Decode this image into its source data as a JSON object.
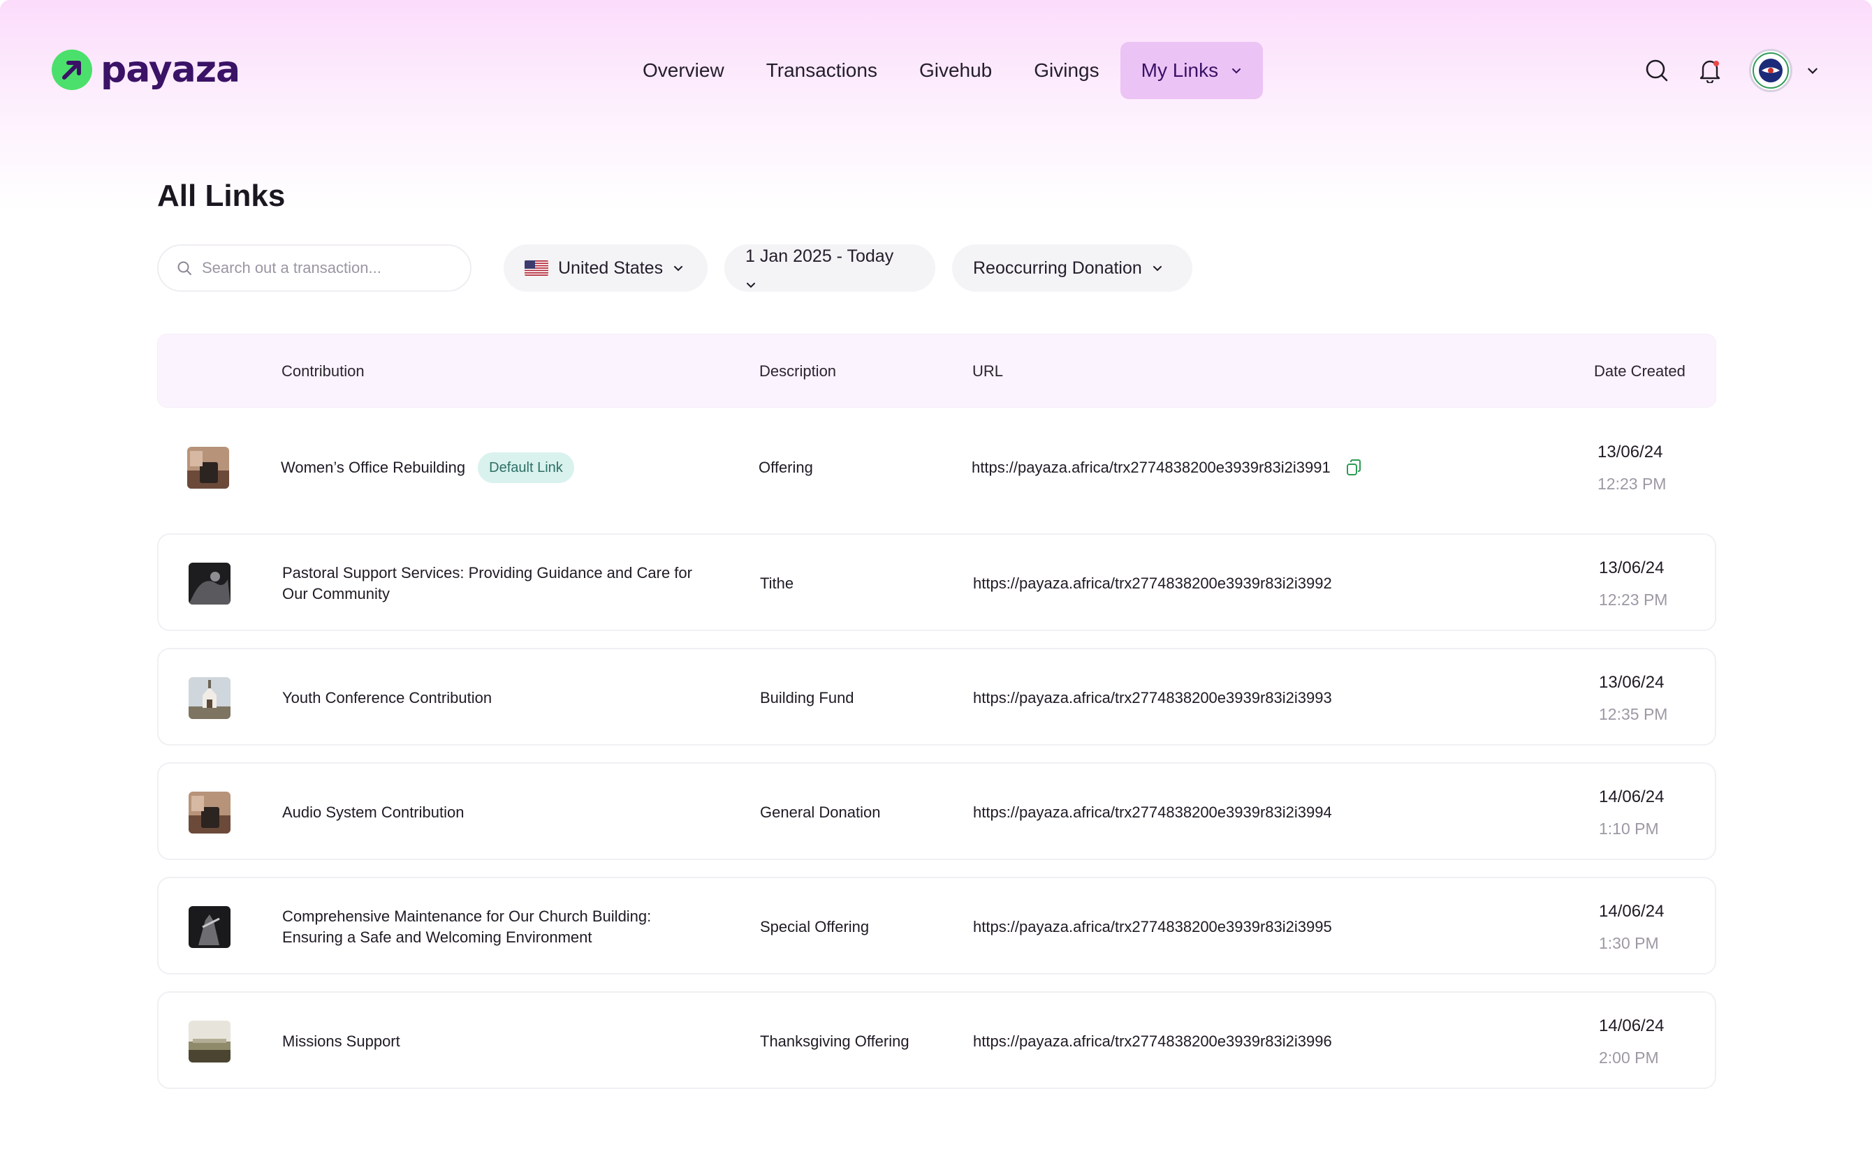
{
  "brand": {
    "name": "payaza"
  },
  "nav": {
    "items": [
      {
        "label": "Overview"
      },
      {
        "label": "Transactions"
      },
      {
        "label": "Givehub"
      },
      {
        "label": "Givings"
      },
      {
        "label": "My Links"
      }
    ],
    "active": "My Links"
  },
  "page": {
    "title": "All Links"
  },
  "filters": {
    "search_placeholder": "Search out a transaction...",
    "country": "United States",
    "date_range": "1 Jan 2025 - Today",
    "type": "Reoccurring Donation"
  },
  "table": {
    "columns": {
      "contribution": "Contribution",
      "description": "Description",
      "url": "URL",
      "date_created": "Date Created"
    },
    "rows": [
      {
        "contribution": "Women’s Office Rebuilding",
        "badge": "Default Link",
        "description": "Offering",
        "url": "https://payaza.africa/trx2774838200e3939r83i2i3991",
        "date": "13/06/24",
        "time": "12:23 PM"
      },
      {
        "contribution": "Pastoral Support Services: Providing Guidance and Care for Our Community",
        "description": "Tithe",
        "url": "https://payaza.africa/trx2774838200e3939r83i2i3992",
        "date": "13/06/24",
        "time": "12:23 PM"
      },
      {
        "contribution": "Youth Conference Contribution",
        "description": "Building Fund",
        "url": "https://payaza.africa/trx2774838200e3939r83i2i3993",
        "date": "13/06/24",
        "time": "12:35 PM"
      },
      {
        "contribution": "Audio System Contribution",
        "description": "General Donation",
        "url": "https://payaza.africa/trx2774838200e3939r83i2i3994",
        "date": "14/06/24",
        "time": "1:10 PM"
      },
      {
        "contribution": "Comprehensive Maintenance for Our Church Building: Ensuring a Safe and Welcoming Environment",
        "description": "Special Offering",
        "url": "https://payaza.africa/trx2774838200e3939r83i2i3995",
        "date": "14/06/24",
        "time": "1:30 PM"
      },
      {
        "contribution": "Missions Support",
        "description": "Thanksgiving Offering",
        "url": "https://payaza.africa/trx2774838200e3939r83i2i3996",
        "date": "14/06/24",
        "time": "2:00 PM"
      }
    ]
  },
  "colors": {
    "brand_purple": "#3a1266",
    "brand_green": "#4be06b",
    "nav_active_bg": "#ecc3f5",
    "badge_bg": "#d9f2ee",
    "badge_text": "#2d6f66"
  },
  "icons": [
    "search-icon",
    "bell-icon",
    "chevron-down-icon",
    "copy-icon",
    "us-flag-icon",
    "avatar-seal-icon"
  ]
}
